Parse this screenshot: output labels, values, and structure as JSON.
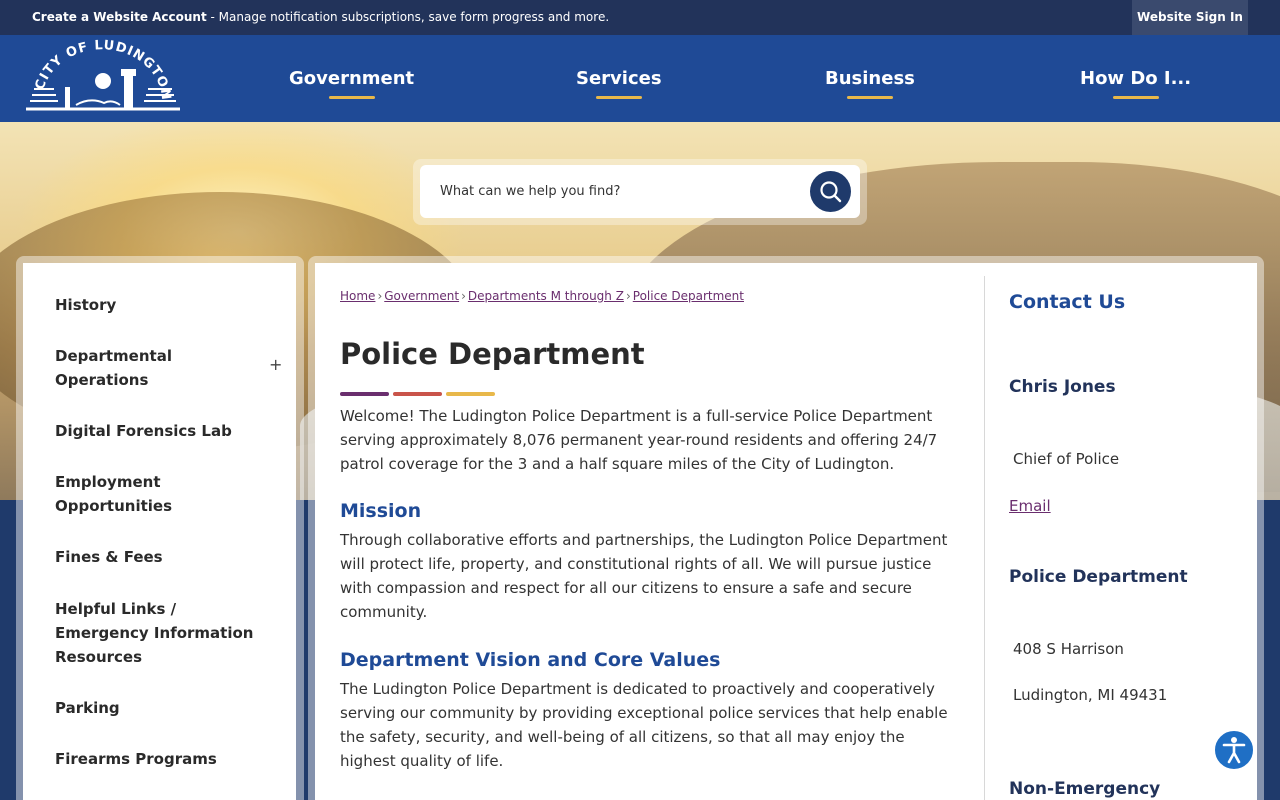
{
  "topbar": {
    "create_account": "Create a Website Account",
    "message": " - Manage notification subscriptions, save form progress and more.",
    "signin": "Website Sign In"
  },
  "logo": {
    "text": "CITY OF LUDINGTON"
  },
  "nav": [
    "Government",
    "Services",
    "Business",
    "How Do I..."
  ],
  "search": {
    "placeholder": "What can we help you find?"
  },
  "sidebar": {
    "items": [
      {
        "label": "History"
      },
      {
        "label": "Departmental Operations",
        "expand": "+"
      },
      {
        "label": "Digital Forensics Lab"
      },
      {
        "label": "Employment Opportunities"
      },
      {
        "label": "Fines & Fees"
      },
      {
        "label": "Helpful Links / Emergency Information Resources"
      },
      {
        "label": "Parking"
      },
      {
        "label": "Firearms Programs"
      }
    ]
  },
  "breadcrumb": [
    "Home",
    "Government",
    "Departments M through Z",
    "Police Department"
  ],
  "breadcrumb_sep": "›",
  "page": {
    "title": "Police Department",
    "accent_colors": [
      "#6a2e6e",
      "#c9544a",
      "#e8b84a"
    ],
    "welcome": "Welcome! The Ludington Police Department is a full-service Police Department serving approximately 8,076 permanent year-round residents and offering 24/7 patrol coverage for the 3 and a half square miles of the City of Ludington.",
    "mission_heading": "Mission",
    "mission": "Through collaborative efforts and partnerships, the Ludington Police Department will protect life, property, and constitutional rights of all. We will pursue justice with compassion and respect for all our citizens to ensure a safe and secure community.",
    "vision_heading": "Department Vision and Core Values",
    "vision": "The Ludington Police Department is dedicated to proactively and cooperatively serving our community by providing exceptional police services that help enable the safety, security, and well-being of all citizens, so that all may enjoy the highest quality of life."
  },
  "contact": {
    "title": "Contact Us",
    "name": "Chris Jones",
    "role": "Chief of Police",
    "email": "Email",
    "dept": "Police Department",
    "address1": "408 S Harrison",
    "address2": "Ludington, MI 49431",
    "next_heading": "Non-Emergency"
  }
}
